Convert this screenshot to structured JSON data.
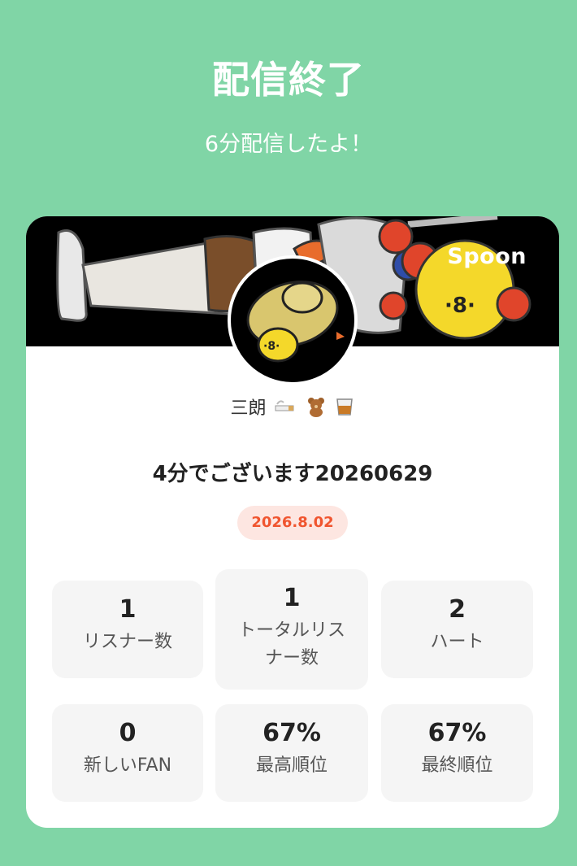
{
  "header": {
    "title": "配信終了",
    "subtitle": "6分配信したよ！"
  },
  "card": {
    "brand": "Spoon",
    "username": "三朗",
    "username_emojis": [
      "cigarette-icon",
      "teddy-bear-icon",
      "whiskey-glass-icon"
    ],
    "live_title": "4分でございます20260629",
    "date": "2026.8.02",
    "stats": [
      {
        "value": "1",
        "label": "リスナー数"
      },
      {
        "value": "1",
        "label": "トータルリスナー数"
      },
      {
        "value": "2",
        "label": "ハート"
      },
      {
        "value": "0",
        "label": "新しいFAN"
      },
      {
        "value": "67%",
        "label": "最高順位"
      },
      {
        "value": "67%",
        "label": "最終順位"
      }
    ]
  },
  "colors": {
    "background": "#80d5a6",
    "accent_badge_text": "#f0552f",
    "accent_badge_bg": "#fde6e1"
  }
}
